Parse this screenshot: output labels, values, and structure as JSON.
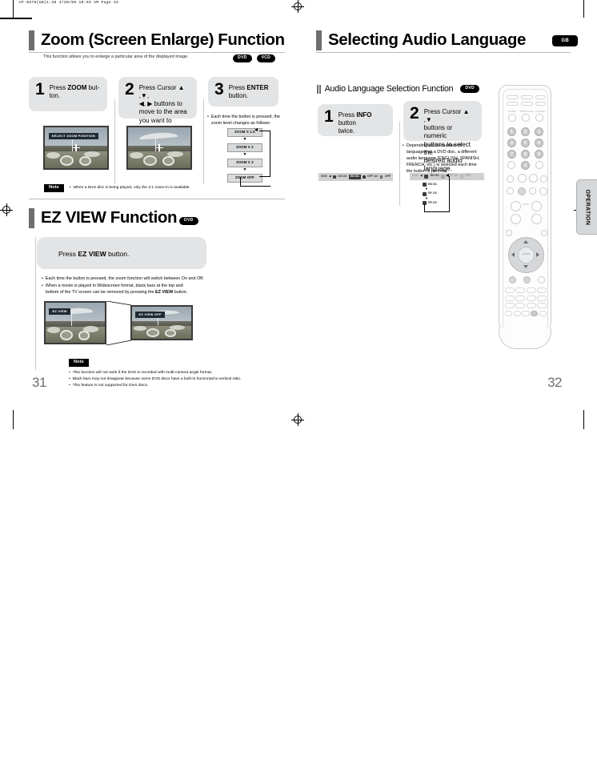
{
  "print_header": "HT-DS79(GB)1-38   4/20/06 10:55 AM   Page 34",
  "left_page": {
    "page_number": "31",
    "section1": {
      "title": "Zoom (Screen Enlarge) Function",
      "subtitle": "This function allows you to enlarge a particular area of the displayed image.",
      "badges": [
        "DVD",
        "VCD"
      ],
      "steps": [
        {
          "num": "1",
          "lines": [
            "Press ",
            "ZOOM",
            " but-",
            "ton."
          ],
          "text_plain": "Press ZOOM button."
        },
        {
          "num": "2",
          "text_plain": "Press Cursor ▲ ,▼, ◀, ▶ buttons to move to the area you want to enlarge."
        },
        {
          "num": "3",
          "text_plain": "Press ENTER button."
        }
      ],
      "step1_tv_label": "SELECT ZOOM POSITION",
      "step3_bullet": "Each time the button is pressed, the zoom level changes as follows:",
      "zoom_levels": [
        "ZOOM X 1.5",
        "ZOOM X 2",
        "ZOOM X 3",
        "ZOOM OFF"
      ],
      "note_tag": "Note",
      "note_text": "When a DivX disc is being played, only the 2:1 zoom-in is available."
    },
    "section2": {
      "title": "EZ VIEW Function",
      "badges": [
        "DVD"
      ],
      "panel_text": "Press EZ VIEW button.",
      "bullets": [
        "Each time the button is pressed, the zoom function will switch between On and Off.",
        "When a movie is played in Widescreen format, black bars at the top and bottom of the TV screen can be removed by pressing the EZ VIEW button."
      ],
      "tv_left_label": "EZ VIEW",
      "tv_right_label": "EZ VIEW OFF",
      "note_tag": "Note",
      "notes": [
        "This function will not work if the DVD is recorded with multi-camera angle format.",
        "Black bars may not disappear because some DVD discs have a built-in horizontal to vertical ratio.",
        "This feature is not supported for DivX discs."
      ]
    }
  },
  "right_page": {
    "page_number": "32",
    "region_badge": "GB",
    "side_tab": "OPERATION",
    "section": {
      "title": "Selecting Audio Language",
      "subsection_title": "Audio Language Selection Function",
      "badges": [
        "DVD"
      ],
      "steps": [
        {
          "num": "1",
          "text_plain": "Press INFO button twice."
        },
        {
          "num": "2",
          "text_plain": "Press Cursor ▲ ,▼ buttons or numeric buttons to select the desired audio language."
        }
      ],
      "bullet": "Depending on the number of languages on a DVD disc, a different audio language (ENGLISH, SPANISH, FRENCH, etc.) is selected each time the button is pressed.",
      "osd_bar": {
        "items": [
          "DVD",
          "CH 1/3",
          "EN 5/1",
          "OFF 1/2",
          "OFF"
        ],
        "label_disc": "DVD",
        "label_chapter": "CH 1/3",
        "label_audio": "EN 5/1",
        "label_subtitle": "OFF 1/2",
        "label_repeat": "OFF"
      },
      "language_list": [
        "EN 5/1",
        "SP 2/0",
        "FR 2/0"
      ]
    },
    "remote": {
      "numeric_keys": [
        "1",
        "2",
        "3",
        "4",
        "5",
        "6",
        "7",
        "8",
        "9",
        "0"
      ],
      "labels": {
        "power": "POWER",
        "open_close": "OPEN/CLOSE",
        "tv_video": "TV/VIDEO",
        "enter": "ENTER",
        "mute": "MUTE"
      }
    }
  },
  "colors": {
    "accent_bar": "#6d6e70",
    "panel_grey": "#e3e4e5",
    "badge_black": "#000000",
    "page_number": "#6d6e70"
  }
}
